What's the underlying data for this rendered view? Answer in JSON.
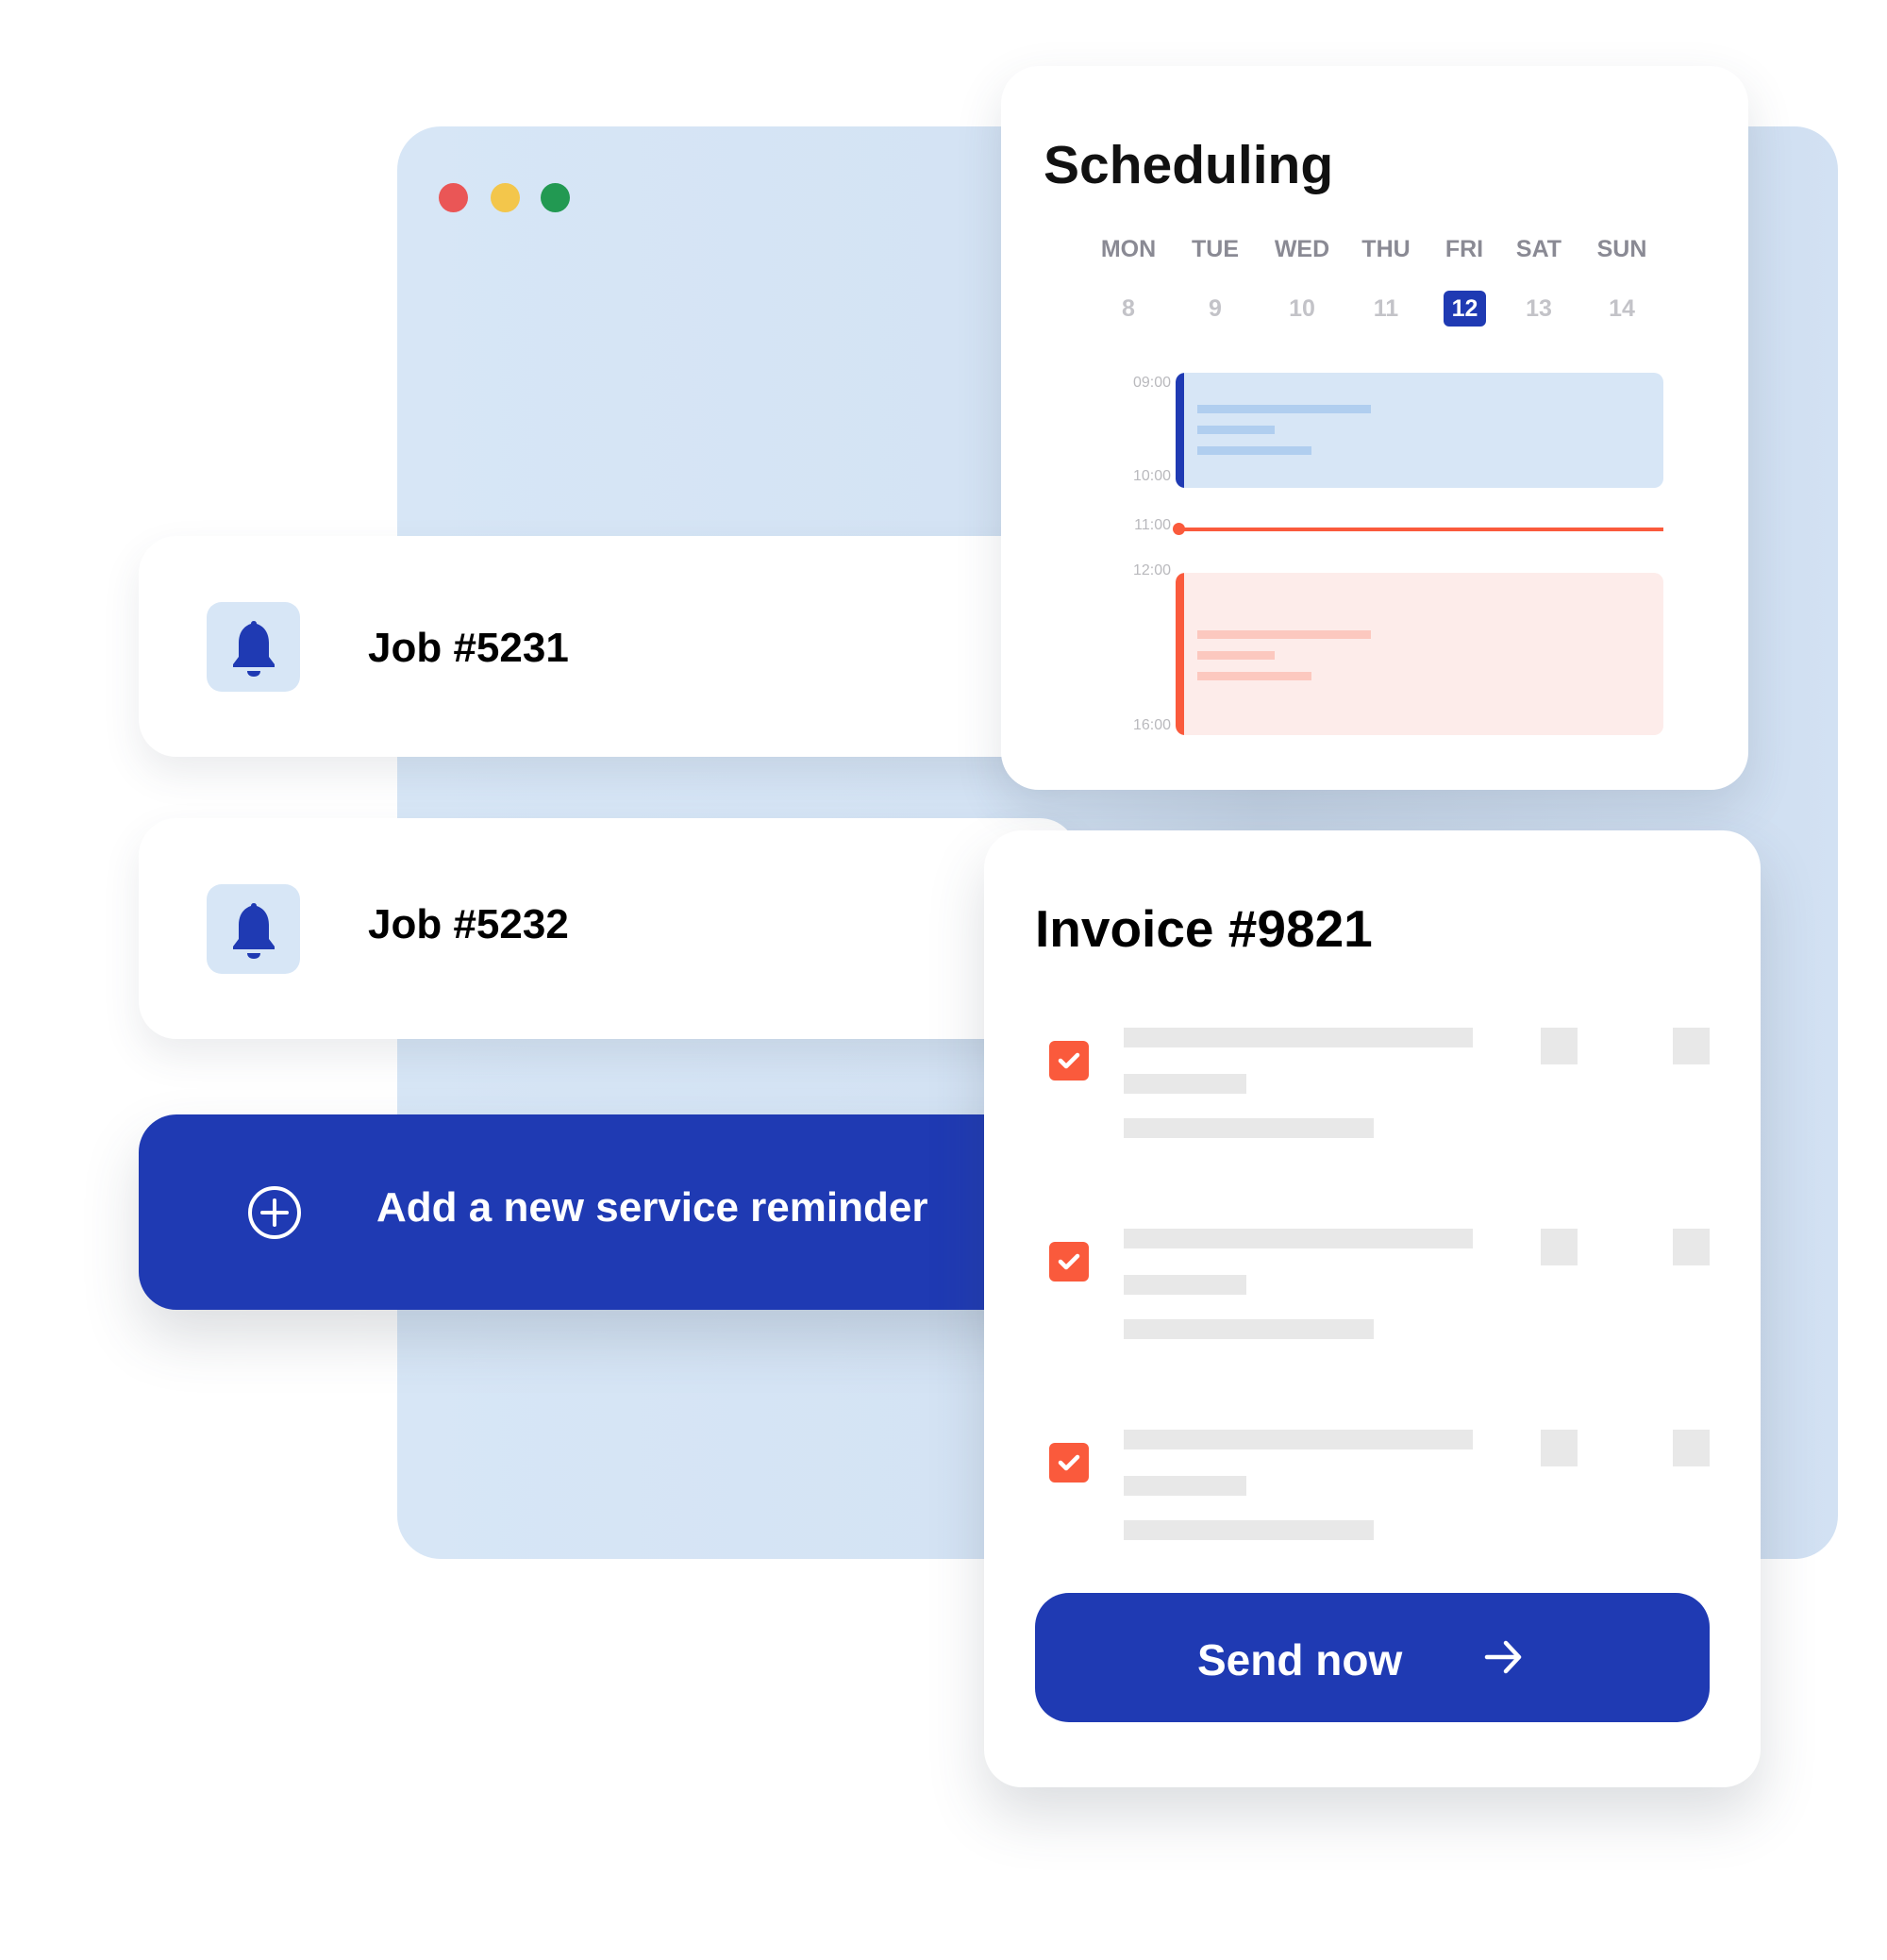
{
  "window": {
    "controls": [
      {
        "name": "close",
        "color": "#ea5656"
      },
      {
        "name": "minimize",
        "color": "#f3c64b"
      },
      {
        "name": "maximize",
        "color": "#229952"
      }
    ],
    "background_color": "#d7e6f6"
  },
  "jobs": [
    {
      "title": "Job #5231",
      "icon": "bell-icon"
    },
    {
      "title": "Job #5232",
      "icon": "bell-icon"
    }
  ],
  "add_reminder": {
    "label": "Add a new service reminder",
    "icon": "plus-circle-icon"
  },
  "scheduling": {
    "title": "Scheduling",
    "days": [
      {
        "name": "MON",
        "date": "8"
      },
      {
        "name": "TUE",
        "date": "9"
      },
      {
        "name": "WED",
        "date": "10"
      },
      {
        "name": "THU",
        "date": "11"
      },
      {
        "name": "FRI",
        "date": "12",
        "selected": true
      },
      {
        "name": "SAT",
        "date": "13"
      },
      {
        "name": "SUN",
        "date": "14"
      }
    ],
    "time_labels": [
      "09:00",
      "10:00",
      "11:00",
      "12:00",
      "16:00"
    ],
    "events": [
      {
        "start": "09:00",
        "end": "10:00",
        "accent": "#1f3ab3",
        "fill": "#d7e6f6",
        "line_color": "#b0ceef"
      },
      {
        "start": "12:00",
        "end": "16:00",
        "accent": "#fa5a3c",
        "fill": "#fdecea",
        "line_color": "#fcc8bf"
      }
    ],
    "current_time": "11:00",
    "current_time_color": "#fa5a3c"
  },
  "invoice": {
    "title": "Invoice #9821",
    "items": [
      {
        "checked": true
      },
      {
        "checked": true
      },
      {
        "checked": true
      }
    ],
    "send_label": "Send now",
    "send_icon": "arrow-right-icon"
  },
  "colors": {
    "brand": "#1f3ab3",
    "accent": "#fa5a3c",
    "placeholder": "#e8e8e8"
  }
}
